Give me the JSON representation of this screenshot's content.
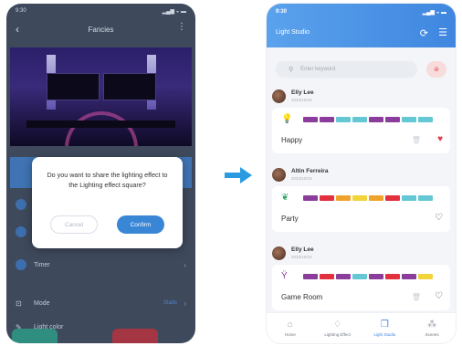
{
  "colors": {
    "brand_blue": "#3f86e0",
    "heart_red": "#e23b4a",
    "dim_overlay": "#3e4a5c"
  },
  "left_phone": {
    "status_time": "9:30",
    "status_icons": "▂▄▆ ◒ ▬",
    "header_title": "Fancies",
    "back_icon": "back-icon",
    "more_icon": "more-icon",
    "dialog": {
      "message": "Do you want to share the lighting effect to the Lighting effect square?",
      "cancel_label": "Cancel",
      "confirm_label": "Confirm"
    },
    "rows": [
      {
        "label": "Timer"
      },
      {
        "label": "Mode",
        "value": "Static"
      },
      {
        "label": "Light color"
      }
    ]
  },
  "right_phone": {
    "status_time": "9:30",
    "status_icons": "▂▄▆ ◒ ▬",
    "title": "Light Studio",
    "search_placeholder": "Enter keyword",
    "posts": [
      {
        "user": "Elly Lee",
        "date": "2023/10/19",
        "effect_name": "Happy",
        "icon": "bulb-icon",
        "segments": [
          "#8b3d9b",
          "#8b3d9b",
          "#63c7d4",
          "#63c7d4",
          "#8b3d9b",
          "#8b3d9b",
          "#63c7d4",
          "#63c7d4"
        ],
        "liked": true,
        "deletable": true
      },
      {
        "user": "Altin Ferreira",
        "date": "2023/10/19",
        "effect_name": "Party",
        "icon": "leaf-icon",
        "segments": [
          "#8b3d9b",
          "#e2303e",
          "#f0a32c",
          "#f0d43a",
          "#f0a32c",
          "#e2303e",
          "#63c7d4",
          "#63c7d4"
        ],
        "liked": false,
        "deletable": false
      },
      {
        "user": "Elly Lee",
        "date": "2023/10/19",
        "effect_name": "Game Room",
        "icon": "figure-icon",
        "segments": [
          "#8b3d9b",
          "#e2303e",
          "#8b3d9b",
          "#63c7d4",
          "#8b3d9b",
          "#e2303e",
          "#8b3d9b",
          "#f0d43a"
        ],
        "liked": false,
        "deletable": true
      }
    ],
    "tabs": [
      {
        "label": "Home",
        "icon": "home-icon",
        "active": false
      },
      {
        "label": "Lighting Effect",
        "icon": "lighting-effect-icon",
        "active": false
      },
      {
        "label": "Light Studio",
        "icon": "light-studio-icon",
        "active": true
      },
      {
        "label": "Scenes",
        "icon": "scenes-icon",
        "active": false
      }
    ]
  }
}
